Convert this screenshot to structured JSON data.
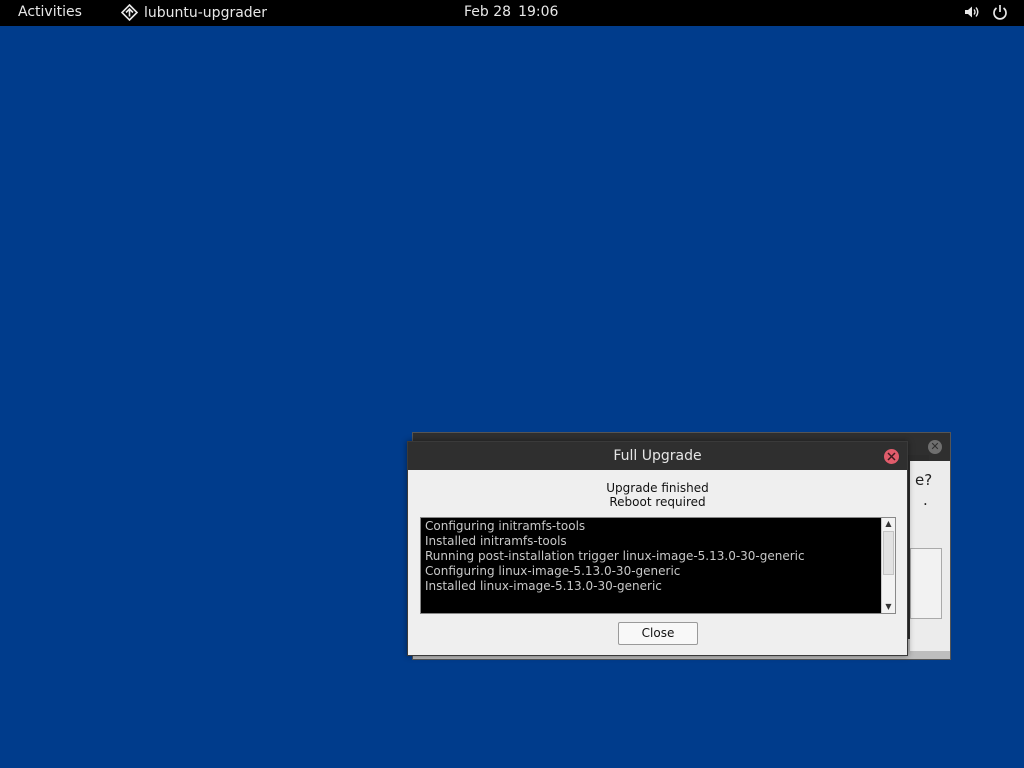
{
  "topbar": {
    "activities_label": "Activities",
    "app_name": "lubuntu-upgrader",
    "app_icon": "lubuntu-upgrader-icon",
    "date": "Feb 28",
    "time": "19:06",
    "volume_icon": "volume-icon",
    "power_icon": "power-icon"
  },
  "background_window": {
    "partial_text": "e?",
    "partial_dot": "."
  },
  "dialog": {
    "title": "Full Upgrade",
    "status_line1": "Upgrade finished",
    "status_line2": "Reboot required",
    "log_lines": [
      "Configuring initramfs-tools",
      "Installed initramfs-tools",
      "Running post-installation trigger linux-image-5.13.0-30-generic",
      "Configuring linux-image-5.13.0-30-generic",
      "Installed linux-image-5.13.0-30-generic"
    ],
    "close_button_label": "Close"
  },
  "colors": {
    "desktop_background": "#003c8c",
    "topbar": "#000000",
    "titlebar": "#2f2f2f",
    "close_accent": "#e05c6b",
    "log_background": "#000000"
  }
}
